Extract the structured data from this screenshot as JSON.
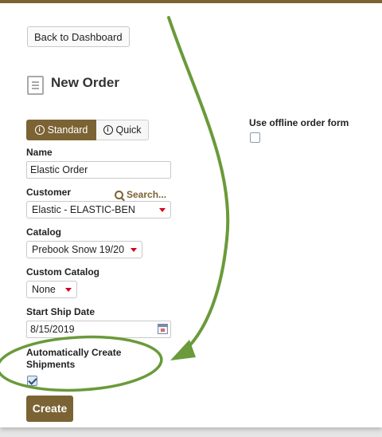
{
  "header": {
    "back_label": "Back to Dashboard",
    "title": "New Order",
    "icon": "document-icon"
  },
  "mode_toggle": {
    "standard_label": "Standard",
    "quick_label": "Quick",
    "active": "Standard"
  },
  "form": {
    "name": {
      "label": "Name",
      "value": "Elastic Order"
    },
    "customer": {
      "label": "Customer",
      "search_label": "Search...",
      "value": "Elastic - ELASTIC-BEN"
    },
    "catalog": {
      "label": "Catalog",
      "value": "Prebook Snow 19/20"
    },
    "custom_catalog": {
      "label": "Custom Catalog",
      "value": "None"
    },
    "start_ship_date": {
      "label": "Start Ship Date",
      "value": "8/15/2019"
    },
    "auto_shipments": {
      "label_line1": "Automatically Create",
      "label_line2": "Shipments",
      "checked": true
    },
    "offline_form": {
      "label": "Use offline order form",
      "checked": false
    },
    "create_label": "Create"
  },
  "colors": {
    "accent": "#7b6334",
    "annotation": "#6a9a3a",
    "caret": "#d0021b"
  }
}
